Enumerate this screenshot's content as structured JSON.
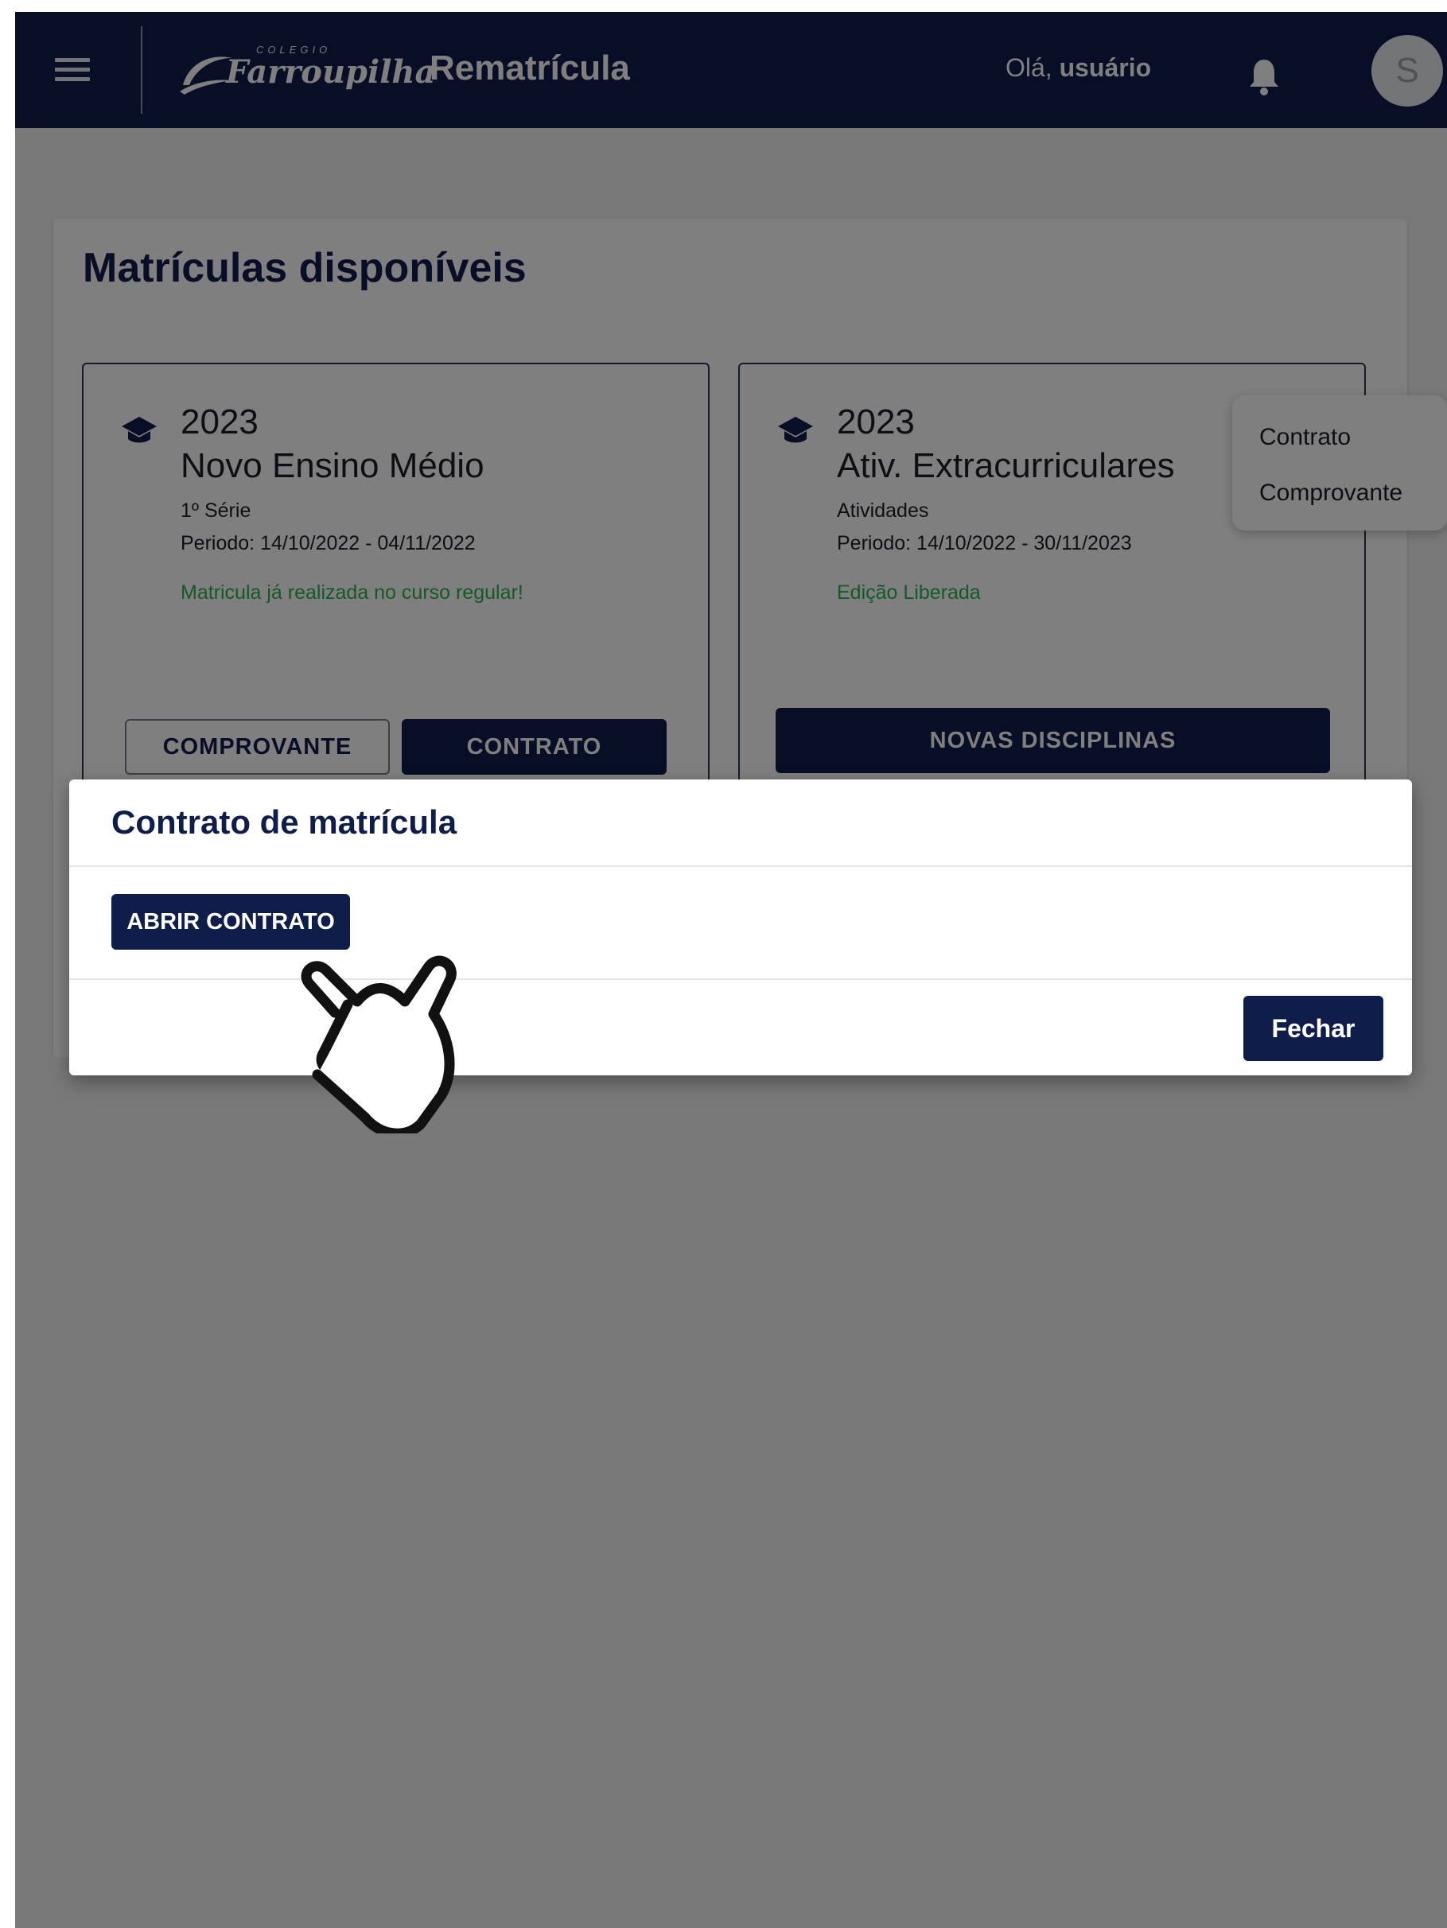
{
  "header": {
    "logo_small_text": "COLEGIO",
    "logo_brand_text": "Farroupilha",
    "app_title": "Rematrícula",
    "greeting_prefix": "Olá, ",
    "greeting_user": "usuário",
    "avatar_initial": "S",
    "icons": [
      "menu-icon",
      "bell-icon"
    ]
  },
  "page": {
    "title": "Matrículas disponíveis"
  },
  "cards": [
    {
      "year": "2023",
      "name": "Novo Ensino Médio",
      "grade": "1º Série",
      "period": "Periodo: 14/10/2022 - 04/11/2022",
      "status": "Matricula já realizada no curso regular!",
      "buttons": {
        "receipt": "COMPROVANTE",
        "contract": "CONTRATO"
      }
    },
    {
      "year": "2023",
      "name": "Ativ. Extracurriculares",
      "grade": "Atividades",
      "period": "Periodo: 14/10/2022 - 30/11/2023",
      "status": "Edição Liberada",
      "buttons": {
        "new_subjects": "NOVAS DISCIPLINAS"
      }
    }
  ],
  "context_menu": {
    "items": [
      "Contrato",
      "Comprovante"
    ]
  },
  "dialog": {
    "title": "Contrato de matrícula",
    "open_label": "ABRIR CONTRATO",
    "close_label": "Fechar"
  },
  "colors": {
    "primary": "#0f1d4a",
    "success": "#2bb24c",
    "overlay": "rgba(0,0,0,0.5)"
  }
}
